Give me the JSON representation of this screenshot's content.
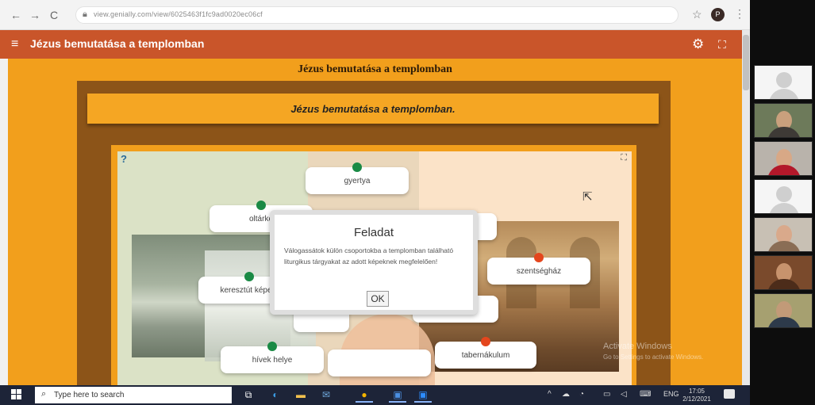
{
  "browser": {
    "back": "←",
    "forward": "→",
    "reload": "C",
    "url": "view.genially.com/view/6025463f1fc9ad0020ec06cf",
    "star": "☆",
    "avatar_letter": "P",
    "menu": "⋮"
  },
  "app": {
    "title": "Jézus bemutatása a templomban",
    "header_color": "#c9552a"
  },
  "banner": {
    "text": "Jézus bemutatása a templomban"
  },
  "inner_title": "Jézus bemutatása a templomban.",
  "game": {
    "labels": [
      {
        "text": "gyertya",
        "dot": "green"
      },
      {
        "text": "oltárke",
        "dot": "green"
      },
      {
        "text": "keresztút képe",
        "dot": "green"
      },
      {
        "text": "hívek helye",
        "dot": "green"
      },
      {
        "text": "szentségház",
        "dot": "red"
      },
      {
        "text": "tabernákulum",
        "dot": "red"
      },
      {
        "text": "",
        "dot": "none"
      },
      {
        "text": "",
        "dot": "none"
      },
      {
        "text": "",
        "dot": "none"
      },
      {
        "text": "",
        "dot": "none"
      }
    ]
  },
  "dialog": {
    "title": "Feladat",
    "body": "Válogassátok külön csoportokba a templomban található liturgikus tárgyakat az adott képeknek megfelelően!",
    "ok": "OK"
  },
  "taskbar": {
    "search_placeholder": "Type here to search",
    "lang": "ENG",
    "time": "17:05",
    "date": "2/12/2021"
  },
  "watermark": [
    "Activate Windows",
    "Go to Settings to activate Windows."
  ],
  "colors": {
    "orange": "#f29f1c",
    "brown": "#8c5418",
    "green_dot": "#1a8a45",
    "red_dot": "#e4461d"
  }
}
